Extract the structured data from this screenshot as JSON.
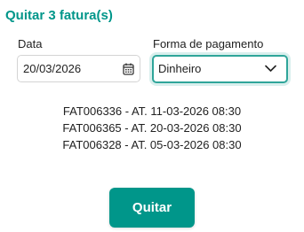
{
  "header": {
    "title": "Quitar 3 fatura(s)"
  },
  "form": {
    "date_label": "Data",
    "date_value": "20/03/2026",
    "payment_label": "Forma de pagamento",
    "payment_selected": "Dinheiro"
  },
  "invoices": [
    "FAT006336 - AT. 11-03-2026 08:30",
    "FAT006365 - AT. 20-03-2026 08:30",
    "FAT006328 - AT. 05-03-2026 08:30"
  ],
  "actions": {
    "submit_label": "Quitar"
  },
  "colors": {
    "accent": "#00968a",
    "focus_border": "#2fa59a"
  },
  "icons": {
    "date": "calendar-icon",
    "select": "chevron-down-icon"
  }
}
